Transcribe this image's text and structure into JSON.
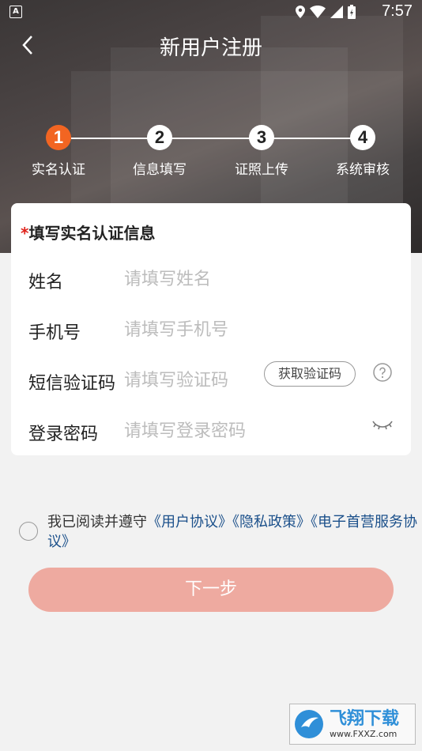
{
  "status_bar": {
    "time": "7:57",
    "app_icon": "A"
  },
  "header": {
    "title": "新用户注册"
  },
  "steps": [
    {
      "num": "1",
      "label": "实名认证",
      "active": true
    },
    {
      "num": "2",
      "label": "信息填写",
      "active": false
    },
    {
      "num": "3",
      "label": "证照上传",
      "active": false
    },
    {
      "num": "4",
      "label": "系统审核",
      "active": false
    }
  ],
  "form": {
    "required_mark": "*",
    "title": "填写实名认证信息",
    "name": {
      "label": "姓名",
      "placeholder": "请填写姓名",
      "value": ""
    },
    "phone": {
      "label": "手机号",
      "placeholder": "请填写手机号",
      "value": ""
    },
    "sms": {
      "label": "短信验证码",
      "placeholder": "请填写验证码",
      "value": "",
      "button": "获取验证码"
    },
    "password": {
      "label": "登录密码",
      "placeholder": "请填写登录密码",
      "value": ""
    }
  },
  "agreement": {
    "prefix": "我已阅读并遵守",
    "link1": "《用户协议》",
    "link2": "《隐私政策》",
    "link3": "《电子首营服务协议》",
    "checked": false
  },
  "next_button": "下一步",
  "watermark": {
    "name": "飞翔下载",
    "url": "www.FXXZ.com"
  },
  "colors": {
    "accent": "#f26522",
    "button": "#eeaaa0",
    "link": "#1a4f8a"
  }
}
